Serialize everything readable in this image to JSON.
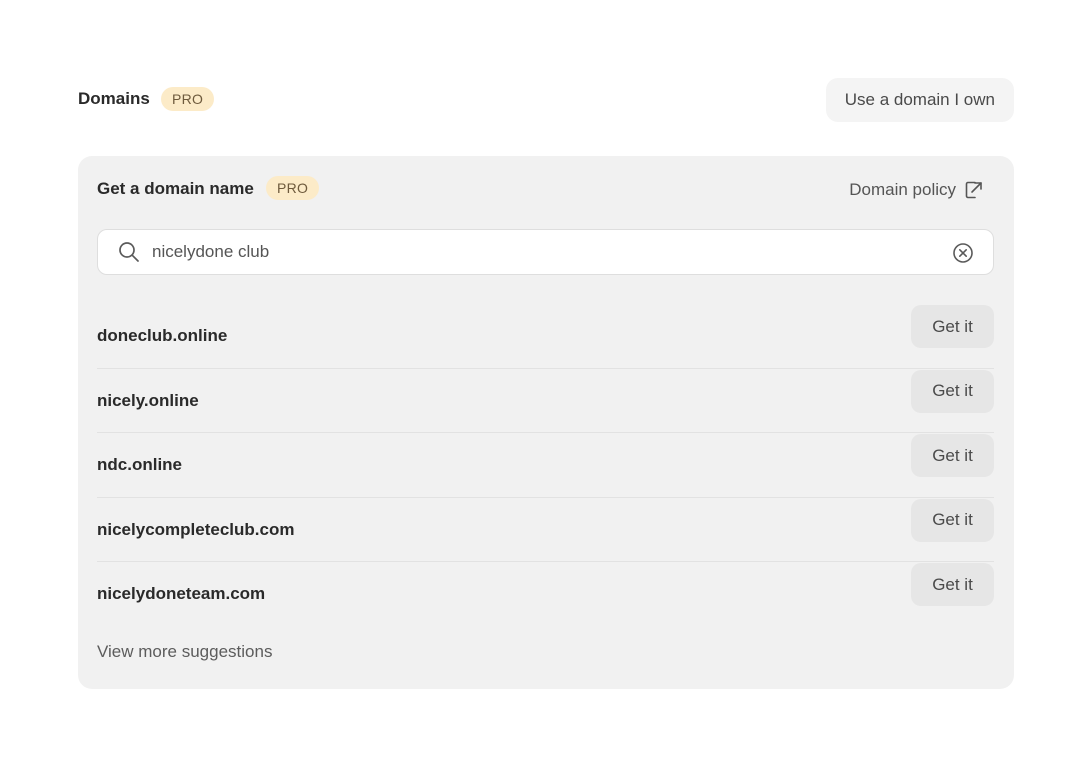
{
  "header": {
    "title": "Domains",
    "badge": "PRO",
    "own_domain_label": "Use a domain I own"
  },
  "card": {
    "title": "Get a domain name",
    "badge": "PRO",
    "policy_label": "Domain policy",
    "policy_icon": "external-link-icon"
  },
  "search": {
    "value": "nicelydone club",
    "icon": "search-icon",
    "clear_icon": "clear-icon"
  },
  "suggestions": [
    {
      "name": "doneclub.online",
      "action": "Get it"
    },
    {
      "name": "nicely.online",
      "action": "Get it"
    },
    {
      "name": "ndc.online",
      "action": "Get it"
    },
    {
      "name": "nicelycompleteclub.com",
      "action": "Get it"
    },
    {
      "name": "nicelydoneteam.com",
      "action": "Get it"
    }
  ],
  "more_label": "View more suggestions",
  "colors": {
    "badge_bg": "#fcebc8",
    "card_bg": "#f1f1f1",
    "button_bg": "#e6e6e6"
  }
}
